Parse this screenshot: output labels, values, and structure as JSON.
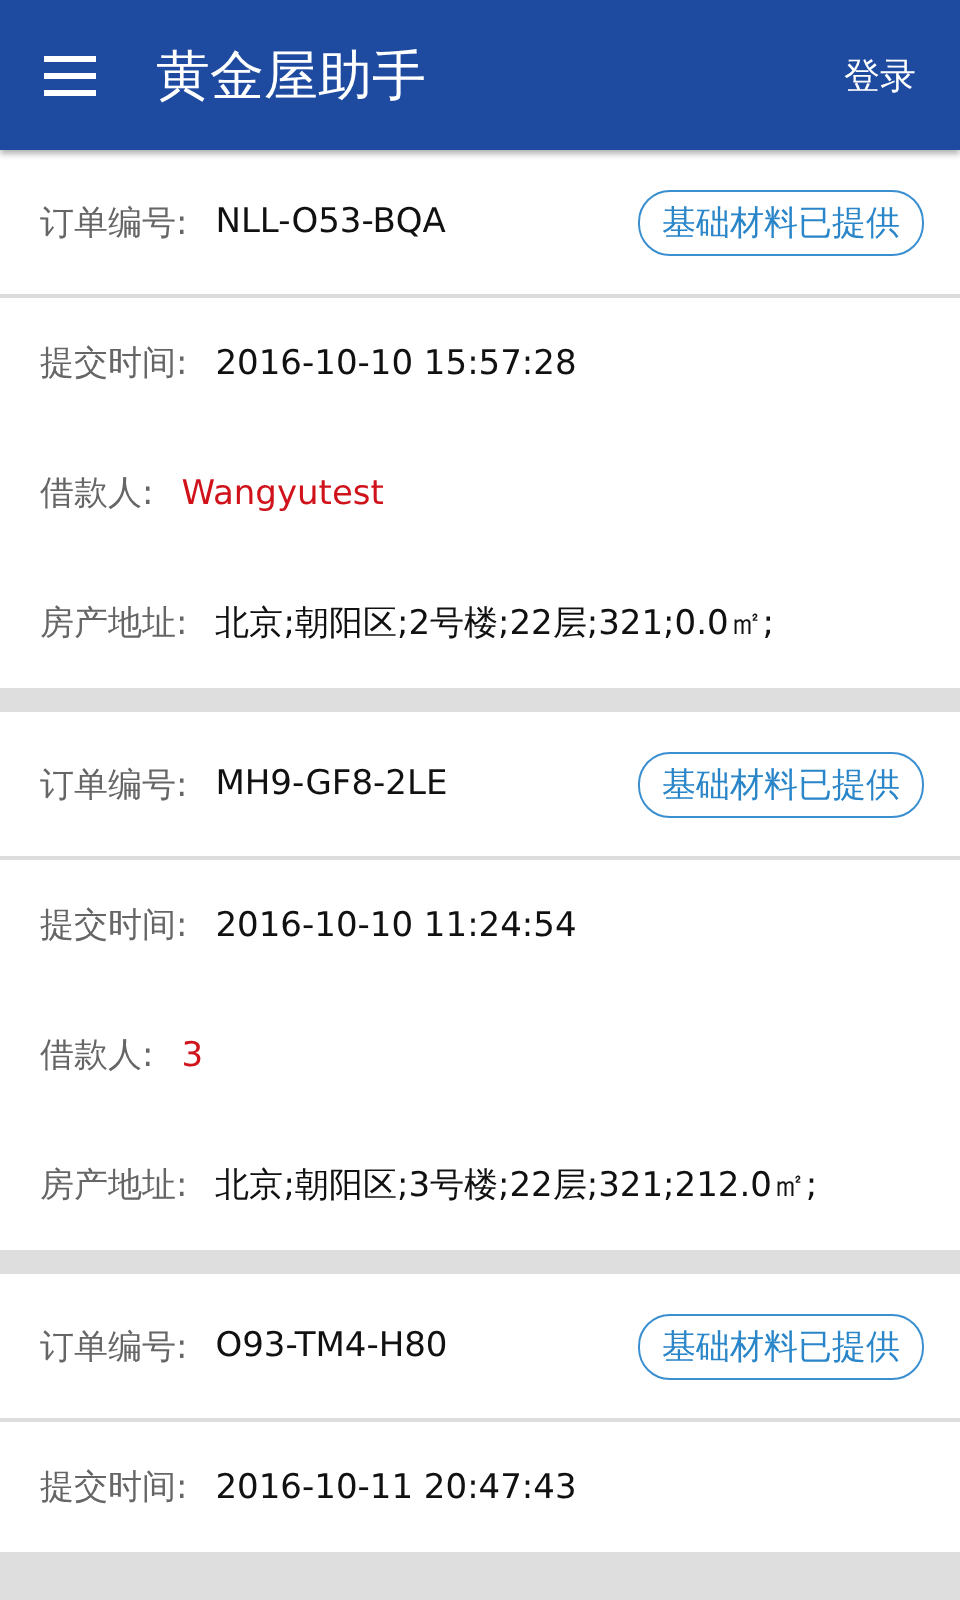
{
  "header": {
    "title": "黄金屋助手",
    "login": "登录"
  },
  "orders": [
    {
      "order_label": "订单编号:",
      "order_no": "NLL-O53-BQA",
      "status": "基础材料已提供",
      "rows": [
        {
          "kind": "time",
          "label": "提交时间:",
          "value": "2016-10-10 15:57:28"
        },
        {
          "kind": "borrower",
          "label": "借款人:",
          "value": "Wangyutest"
        },
        {
          "kind": "address",
          "label": "房产地址:",
          "value": "北京;朝阳区;2号楼;22层;321;0.0㎡;"
        }
      ]
    },
    {
      "order_label": "订单编号:",
      "order_no": "MH9-GF8-2LE",
      "status": "基础材料已提供",
      "rows": [
        {
          "kind": "time",
          "label": "提交时间:",
          "value": "2016-10-10 11:24:54"
        },
        {
          "kind": "borrower",
          "label": "借款人:",
          "value": "3"
        },
        {
          "kind": "address",
          "label": "房产地址:",
          "value": "北京;朝阳区;3号楼;22层;321;212.0㎡;"
        }
      ]
    },
    {
      "order_label": "订单编号:",
      "order_no": "O93-TM4-H80",
      "status": "基础材料已提供",
      "rows": [
        {
          "kind": "time",
          "label": "提交时间:",
          "value": "2016-10-11 20:47:43"
        }
      ]
    }
  ]
}
